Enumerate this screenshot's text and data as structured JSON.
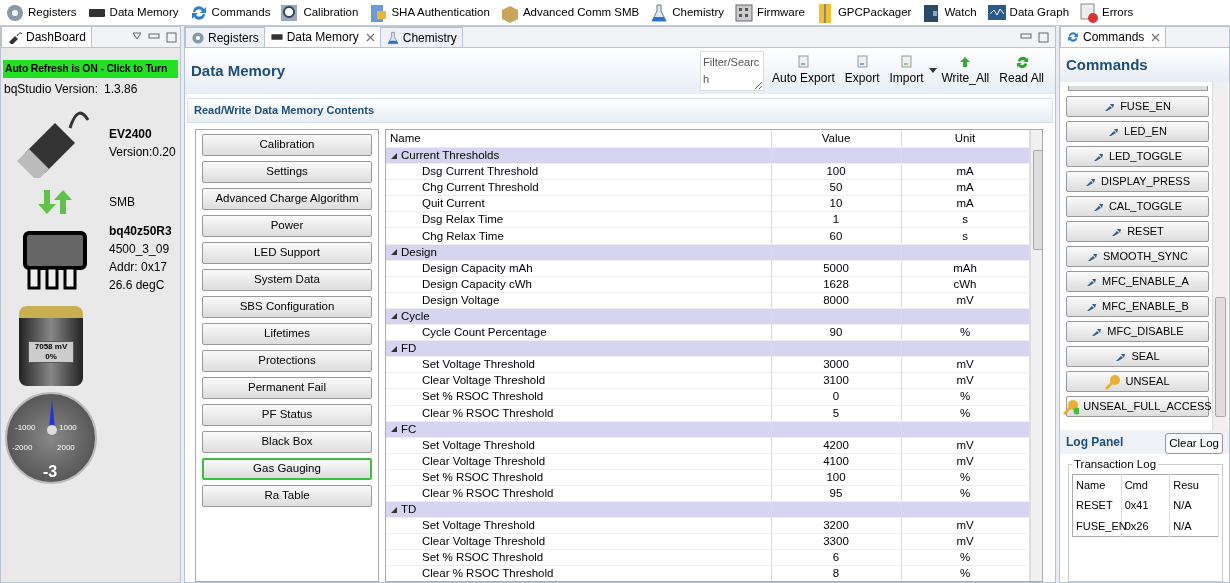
{
  "toolbar": [
    "Registers",
    "Data Memory",
    "Commands",
    "Calibration",
    "SHA Authentication",
    "Advanced Comm SMB",
    "Chemistry",
    "Firmware",
    "GPCPackager",
    "Watch",
    "Data Graph",
    "Errors"
  ],
  "dashboard": {
    "tab": "DashBoard",
    "auto_refresh": "Auto Refresh is ON - Click to Turn",
    "version_label": "bqStudio Version:",
    "version": "1.3.86",
    "adapter": {
      "name": "EV2400",
      "version": "Version:0.20"
    },
    "bus": "SMB",
    "device": {
      "name": "bq40z50R3",
      "firmware": "4500_3_09",
      "address": "Addr: 0x17",
      "temperature": "26.6 degC"
    },
    "battery": {
      "voltage": "7058 mV",
      "soc": "0%"
    },
    "gauge": {
      "labels": [
        "-1000",
        "1000",
        "-2000",
        "2000"
      ],
      "reading": "-3"
    }
  },
  "editor_tabs": [
    {
      "label": "Registers",
      "selected": false,
      "closable": false
    },
    {
      "label": "Data Memory",
      "selected": true,
      "closable": true
    },
    {
      "label": "Chemistry",
      "selected": false,
      "closable": false
    }
  ],
  "data_memory": {
    "title": "Data Memory",
    "filter_placeholder": "Filter/Search",
    "actions": [
      {
        "label": "Auto Export",
        "kind": "doc"
      },
      {
        "label": "Export",
        "kind": "doc"
      },
      {
        "label": "Import",
        "kind": "import"
      },
      {
        "label": "Write_All",
        "kind": "up"
      },
      {
        "label": "Read All",
        "kind": "refresh"
      }
    ],
    "section": "Read/Write Data Memory Contents",
    "categories": [
      {
        "label": "Calibration",
        "selected": false
      },
      {
        "label": "Settings",
        "selected": false
      },
      {
        "label": "Advanced Charge Algorithm",
        "selected": false
      },
      {
        "label": "Power",
        "selected": false
      },
      {
        "label": "LED Support",
        "selected": false
      },
      {
        "label": "System Data",
        "selected": false
      },
      {
        "label": "SBS Configuration",
        "selected": false
      },
      {
        "label": "Lifetimes",
        "selected": false
      },
      {
        "label": "Protections",
        "selected": false
      },
      {
        "label": "Permanent Fail",
        "selected": false
      },
      {
        "label": "PF Status",
        "selected": false
      },
      {
        "label": "Black Box",
        "selected": false
      },
      {
        "label": "Gas Gauging",
        "selected": true
      },
      {
        "label": "Ra Table",
        "selected": false
      }
    ],
    "table": {
      "columns": [
        "Name",
        "Value",
        "Unit"
      ],
      "groups": [
        {
          "name": "Current Thresholds",
          "expanded": true,
          "rows": [
            [
              "Dsg Current Threshold",
              "100",
              "mA"
            ],
            [
              "Chg Current Threshold",
              "50",
              "mA"
            ],
            [
              "Quit Current",
              "10",
              "mA"
            ],
            [
              "Dsg Relax Time",
              "1",
              "s"
            ],
            [
              "Chg Relax Time",
              "60",
              "s"
            ]
          ]
        },
        {
          "name": "Design",
          "expanded": true,
          "rows": [
            [
              "Design Capacity mAh",
              "5000",
              "mAh"
            ],
            [
              "Design Capacity cWh",
              "1628",
              "cWh"
            ],
            [
              "Design Voltage",
              "8000",
              "mV"
            ]
          ]
        },
        {
          "name": "Cycle",
          "expanded": true,
          "rows": [
            [
              "Cycle Count Percentage",
              "90",
              "%"
            ]
          ]
        },
        {
          "name": "FD",
          "expanded": true,
          "rows": [
            [
              "Set Voltage Threshold",
              "3000",
              "mV"
            ],
            [
              "Clear Voltage Threshold",
              "3100",
              "mV"
            ],
            [
              "Set % RSOC Threshold",
              "0",
              "%"
            ],
            [
              "Clear % RSOC Threshold",
              "5",
              "%"
            ]
          ]
        },
        {
          "name": "FC",
          "expanded": true,
          "rows": [
            [
              "Set Voltage Threshold",
              "4200",
              "mV"
            ],
            [
              "Clear Voltage Threshold",
              "4100",
              "mV"
            ],
            [
              "Set % RSOC Threshold",
              "100",
              "%"
            ],
            [
              "Clear % RSOC Threshold",
              "95",
              "%"
            ]
          ]
        },
        {
          "name": "TD",
          "expanded": true,
          "rows": [
            [
              "Set Voltage Threshold",
              "3200",
              "mV"
            ],
            [
              "Clear Voltage Threshold",
              "3300",
              "mV"
            ],
            [
              "Set % RSOC Threshold",
              "6",
              "%"
            ],
            [
              "Clear % RSOC Threshold",
              "8",
              "%"
            ]
          ]
        }
      ]
    }
  },
  "commands": {
    "tab": "Commands",
    "title": "Commands",
    "buttons": [
      {
        "label": "FUSE_EN",
        "kind": "command"
      },
      {
        "label": "LED_EN",
        "kind": "command"
      },
      {
        "label": "LED_TOGGLE",
        "kind": "command"
      },
      {
        "label": "DISPLAY_PRESS",
        "kind": "command"
      },
      {
        "label": "CAL_TOGGLE",
        "kind": "command"
      },
      {
        "label": "RESET",
        "kind": "command"
      },
      {
        "label": "SMOOTH_SYNC",
        "kind": "command"
      },
      {
        "label": "MFC_ENABLE_A",
        "kind": "command"
      },
      {
        "label": "MFC_ENABLE_B",
        "kind": "command"
      },
      {
        "label": "MFC_DISABLE",
        "kind": "command"
      },
      {
        "label": "SEAL",
        "kind": "command"
      },
      {
        "label": "UNSEAL",
        "kind": "key"
      },
      {
        "label": "UNSEAL_FULL_ACCESS",
        "kind": "key_plus"
      }
    ],
    "log_panel": {
      "title": "Log Panel",
      "clear_button": "Clear Log",
      "legend": "Transaction Log",
      "columns": [
        "Name",
        "Cmd",
        "Resu"
      ],
      "rows": [
        [
          "RESET",
          "0x41",
          "N/A"
        ],
        [
          "FUSE_EN",
          "0x26",
          "N/A"
        ]
      ]
    }
  }
}
